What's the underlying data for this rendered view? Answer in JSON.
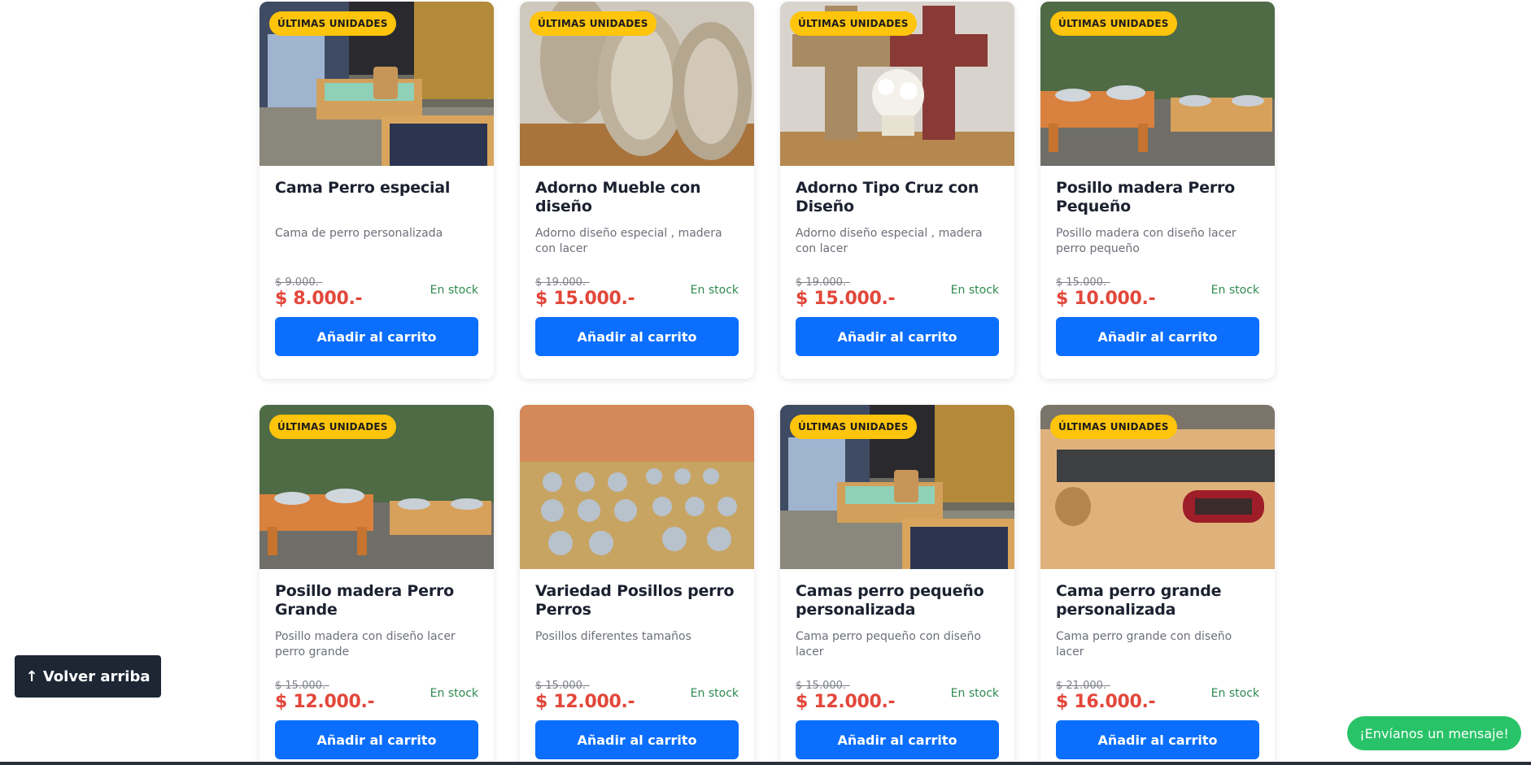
{
  "badge_text": "ÚLTIMAS UNIDADES",
  "add_label": "Añadir al carrito",
  "stock_label": "En stock",
  "products": [
    {
      "title": "Cama Perro especial",
      "desc": "Cama de perro personalizada",
      "old": "$ 9.000.-",
      "new": "$ 8.000.-",
      "badge": true,
      "image": "dog-bed"
    },
    {
      "title": "Adorno Mueble con diseño",
      "desc": "Adorno diseño especial , madera con lacer",
      "old": "$ 19.000.-",
      "new": "$ 15.000.-",
      "badge": true,
      "image": "lace-ornament"
    },
    {
      "title": "Adorno Tipo Cruz con Diseño",
      "desc": "Adorno diseño especial , madera con lacer",
      "old": "$ 19.000.-",
      "new": "$ 15.000.-",
      "badge": true,
      "image": "cross-ornament"
    },
    {
      "title": "Posillo madera Perro Pequeño",
      "desc": "Posillo madera con diseño lacer perro pequeño",
      "old": "$ 15.000.-",
      "new": "$ 10.000.-",
      "badge": true,
      "image": "bowl-stand"
    },
    {
      "title": "Posillo madera Perro Grande",
      "desc": "Posillo madera con diseño lacer perro grande",
      "old": "$ 15.000.-",
      "new": "$ 12.000.-",
      "badge": true,
      "image": "bowl-stand"
    },
    {
      "title": "Variedad Posillos perro Perros",
      "desc": "Posillos diferentes tamaños",
      "old": "$ 15.000.-",
      "new": "$ 12.000.-",
      "badge": false,
      "image": "bowls-variety"
    },
    {
      "title": "Camas perro pequeño personalizada",
      "desc": "Cama perro pequeño con diseño lacer",
      "old": "$ 15.000.-",
      "new": "$ 12.000.-",
      "badge": true,
      "image": "dog-bed"
    },
    {
      "title": "Cama perro grande personalizada",
      "desc": "Cama perro grande con diseño lacer",
      "old": "$ 21.000.-",
      "new": "$ 16.000.-",
      "badge": true,
      "image": "big-bed"
    }
  ],
  "back_to_top": "↑ Volver arriba",
  "message_button": "¡Envíanos un mensaje!",
  "colors": {
    "accent": "#0b6efd",
    "price": "#e2473a",
    "badge": "#ffc40c",
    "stock": "#2e8a4f",
    "whatsapp": "#28c368"
  }
}
